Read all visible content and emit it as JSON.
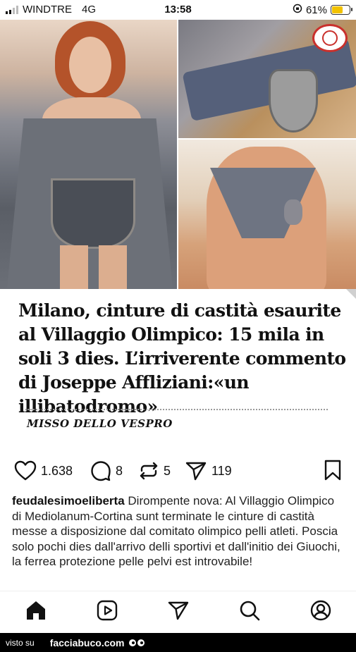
{
  "status_bar": {
    "carrier": "WINDTRE",
    "network": "4G",
    "time": "13:58",
    "battery": "61%",
    "battery_level": 0.61
  },
  "post": {
    "headline": "Milano, cinture di castità esaurite al Villaggio Olimpico: 15 mila in soli 3 dies. L’irriverente commento di Joseppe Affliziani:«un illibatodromo»",
    "source": "MISSO DELLO VESPRO",
    "stats": {
      "likes": "1.638",
      "comments": "8",
      "reposts": "5",
      "shares": "119"
    },
    "caption": {
      "username": "feudalesimoeliberta",
      "text": "Dirompente nova: Al Villaggio Olimpico di Mediolanum-Cortina sunt terminate le cinture di castità messe a disposizione dal comitato olimpico pelli atleti. Poscia solo pochi dies dall'arrivo delli sportivi et dall'initio dei Giuochi, la ferrea protezione pelle pelvi est introvabile!"
    }
  },
  "nav": {
    "items": [
      "home-icon",
      "reels-icon",
      "send-icon",
      "search-icon",
      "profile-icon"
    ]
  },
  "footer": {
    "prefix": "visto su",
    "brand": "facciabuco.com"
  },
  "colors": {
    "accent_red": "#c9302c",
    "battery_yellow": "#f2c200"
  }
}
